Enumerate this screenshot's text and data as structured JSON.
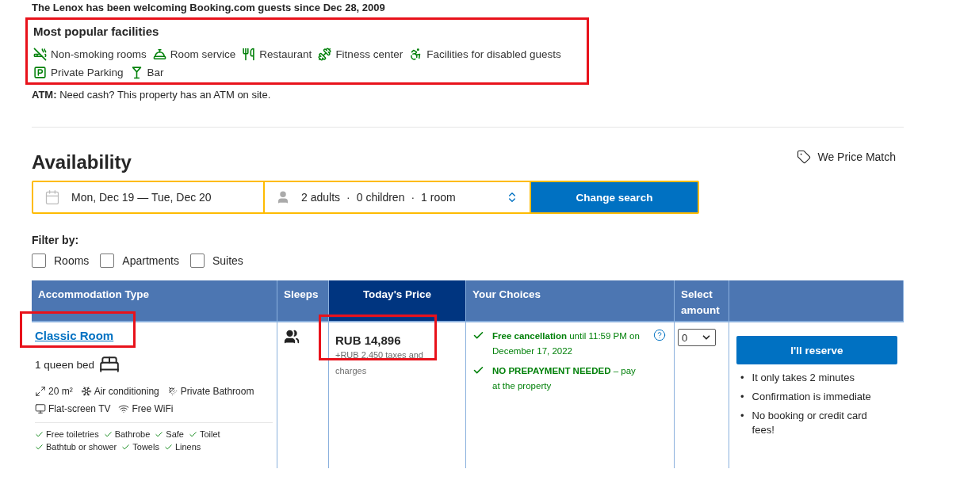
{
  "intro": "The Lenox has been welcoming Booking.com guests since Dec 28, 2009",
  "facilities": {
    "title": "Most popular facilities",
    "highlighted": true,
    "items": [
      "Non-smoking rooms",
      "Room service",
      "Restaurant",
      "Fitness center",
      "Facilities for disabled guests",
      "Private Parking",
      "Bar"
    ]
  },
  "atm": {
    "label": "ATM:",
    "text": "Need cash? This property has an ATM on site."
  },
  "availability": {
    "title": "Availability",
    "price_match": "We Price Match"
  },
  "search": {
    "dates": "Mon, Dec 19 — Tue, Dec 20",
    "guests": [
      "2 adults",
      "0 children",
      "1 room"
    ],
    "separator": "·",
    "button": "Change search"
  },
  "filter": {
    "title": "Filter by:",
    "options": [
      {
        "label": "Rooms",
        "checked": false
      },
      {
        "label": "Apartments",
        "checked": false
      },
      {
        "label": "Suites",
        "checked": false
      }
    ]
  },
  "table": {
    "columns": [
      {
        "label": "Accommodation Type",
        "selected": false
      },
      {
        "label": "Sleeps",
        "selected": false
      },
      {
        "label": "Today's Price",
        "selected": true
      },
      {
        "label": "Your Choices",
        "selected": false
      },
      {
        "label": "Select amount",
        "selected": false
      }
    ],
    "rows": [
      {
        "name": "Classic Room",
        "name_highlighted": true,
        "bed": "1 queen bed",
        "amenities": [
          "20 m²",
          "Air conditioning",
          "Private Bathroom",
          "Flat-screen TV",
          "Free WiFi"
        ],
        "extras": [
          "Free toiletries",
          "Bathrobe",
          "Safe",
          "Toilet",
          "Bathtub or shower",
          "Towels",
          "Linens"
        ],
        "price": "RUB 14,896",
        "taxes": "+RUB 2,450 taxes and charges",
        "price_highlighted": true,
        "choices": [
          {
            "strong": "Free cancellation",
            "text": "until 11:59 PM on December 17, 2022",
            "help": true
          },
          {
            "strong": "NO PREPAYMENT NEEDED",
            "text": "– pay at the property",
            "help": false
          }
        ],
        "amount": "0"
      }
    ]
  },
  "reserve": {
    "button": "I'll reserve",
    "bullet": "•",
    "notes": [
      "It only takes 2 minutes",
      "Confirmation is immediate",
      "No booking or credit card fees!"
    ]
  }
}
